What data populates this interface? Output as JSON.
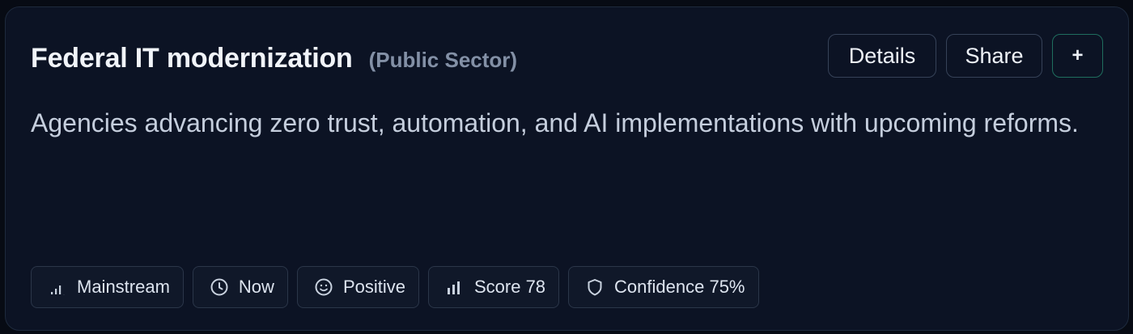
{
  "card": {
    "title": "Federal IT modernization",
    "category": "(Public Sector)",
    "description": "Agencies advancing zero trust, automation, and AI implementations with upcoming reforms.",
    "actions": {
      "details_label": "Details",
      "share_label": "Share",
      "add_label": "+"
    },
    "tags": [
      {
        "icon": "bar-chart-icon",
        "label": "Mainstream"
      },
      {
        "icon": "clock-icon",
        "label": "Now"
      },
      {
        "icon": "smiley-icon",
        "label": "Positive"
      },
      {
        "icon": "bar-chart-icon",
        "label": "Score 78"
      },
      {
        "icon": "shield-icon",
        "label": "Confidence 75%"
      }
    ]
  },
  "colors": {
    "background": "#070b14",
    "card": "#0c1324",
    "border": "#1e2a3d",
    "add_button_accent": "#1f6e5e",
    "muted_text": "#8390a6"
  }
}
